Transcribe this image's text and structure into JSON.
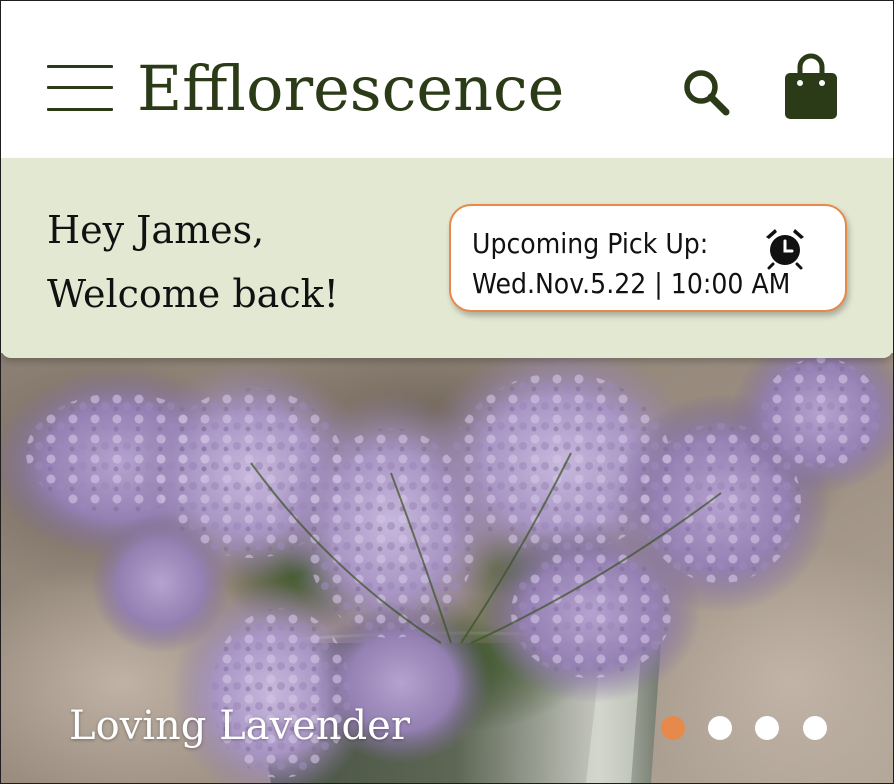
{
  "header": {
    "brand": "Efflorescence",
    "menu_icon": "hamburger-menu-icon",
    "search_icon": "search-icon",
    "bag_icon": "shopping-bag-icon",
    "brand_color": "#2b3a17"
  },
  "banner": {
    "greeting_line1": "Hey James,",
    "greeting_line2": "Welcome back!",
    "background": "#e3e8d2",
    "pickup": {
      "title": "Upcoming Pick Up:",
      "datetime": "Wed.Nov.5.22 | 10:00 AM",
      "icon": "alarm-clock-icon",
      "border_color": "#e6894a"
    }
  },
  "hero": {
    "caption": "Loving Lavender",
    "carousel": {
      "total_slides": 4,
      "active_index": 0,
      "active_color": "#e6894a",
      "inactive_color": "#ffffff"
    }
  }
}
